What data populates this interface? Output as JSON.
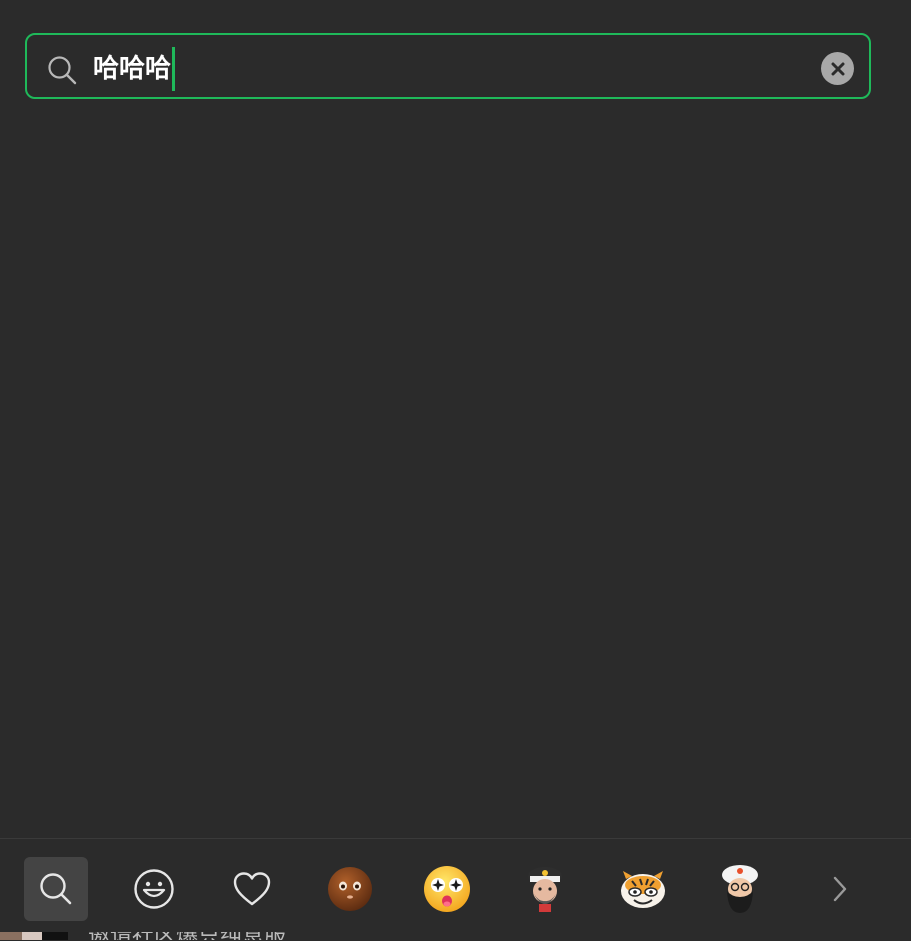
{
  "search": {
    "query": "哈哈哈",
    "clear_icon": "close-circle-icon"
  },
  "colors": {
    "background": "#2b2b2b",
    "accent": "#1fb95a",
    "active_tab": "#444444"
  },
  "tabs": [
    {
      "name": "search",
      "icon": "search-icon",
      "active": true
    },
    {
      "name": "emoji",
      "icon": "smiley-icon",
      "active": false
    },
    {
      "name": "favorites",
      "icon": "heart-icon",
      "active": false
    },
    {
      "name": "sticker-pack-1",
      "icon": "brown-face-sticker-icon",
      "active": false
    },
    {
      "name": "sticker-pack-2",
      "icon": "starry-eyes-face-sticker-icon",
      "active": false
    },
    {
      "name": "sticker-pack-3",
      "icon": "captain-sticker-icon",
      "active": false
    },
    {
      "name": "sticker-pack-4",
      "icon": "tiger-sticker-icon",
      "active": false
    },
    {
      "name": "sticker-pack-5",
      "icon": "chef-beard-sticker-icon",
      "active": false
    }
  ],
  "next_icon": "chevron-right-icon",
  "underlying_text": "邀请社区爆只纯息服"
}
